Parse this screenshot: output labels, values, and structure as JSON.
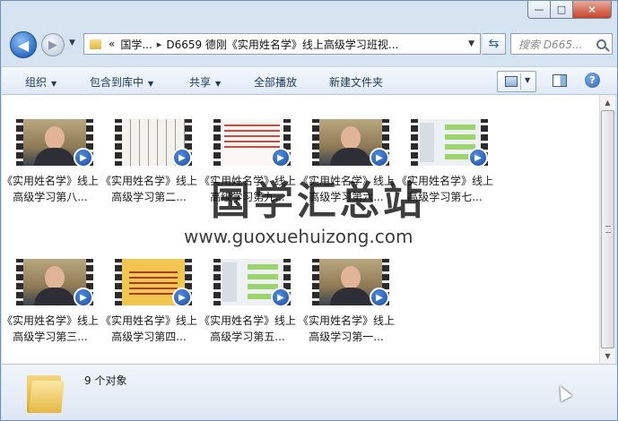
{
  "window": {
    "caption": {
      "minimize": "—",
      "maximize": "□",
      "close": "✕"
    }
  },
  "nav": {
    "back_icon": "back-arrow-icon",
    "forward_icon": "forward-arrow-icon",
    "address": {
      "overflow": "«",
      "crumbs": [
        "国学...",
        "D6659 德刚《实用姓名学》线上高级学习班视..."
      ],
      "separator": "▸"
    },
    "search_placeholder": "搜索 D665..."
  },
  "cmdbar": {
    "organize": "组织",
    "include_library": "包含到库中",
    "share": "共享",
    "play_all": "全部播放",
    "new_folder": "新建文件夹"
  },
  "files": [
    {
      "label": "《实用姓名学》线上高级学习第八...",
      "thumb": "person"
    },
    {
      "label": "《实用姓名学》线上高级学习第二...",
      "thumb": "doc"
    },
    {
      "label": "《实用姓名学》线上高级学习第九...",
      "thumb": "red"
    },
    {
      "label": "《实用姓名学》线上高级学习第六...",
      "thumb": "person"
    },
    {
      "label": "《实用姓名学》线上高级学习第七...",
      "thumb": "chat"
    },
    {
      "label": "《实用姓名学》线上高级学习第三...",
      "thumb": "person"
    },
    {
      "label": "《实用姓名学》线上高级学习第四...",
      "thumb": "yellow"
    },
    {
      "label": "《实用姓名学》线上高级学习第五...",
      "thumb": "chat"
    },
    {
      "label": "《实用姓名学》线上高级学习第一...",
      "thumb": "person"
    }
  ],
  "watermark": {
    "text": "国学汇总站",
    "url": "www.guoxuehuizong.com"
  },
  "status": {
    "count_text": "9 个对象"
  },
  "colors": {
    "accent": "#2c6fc7",
    "command_text": "#1e395b",
    "close_button": "#c7432b"
  }
}
